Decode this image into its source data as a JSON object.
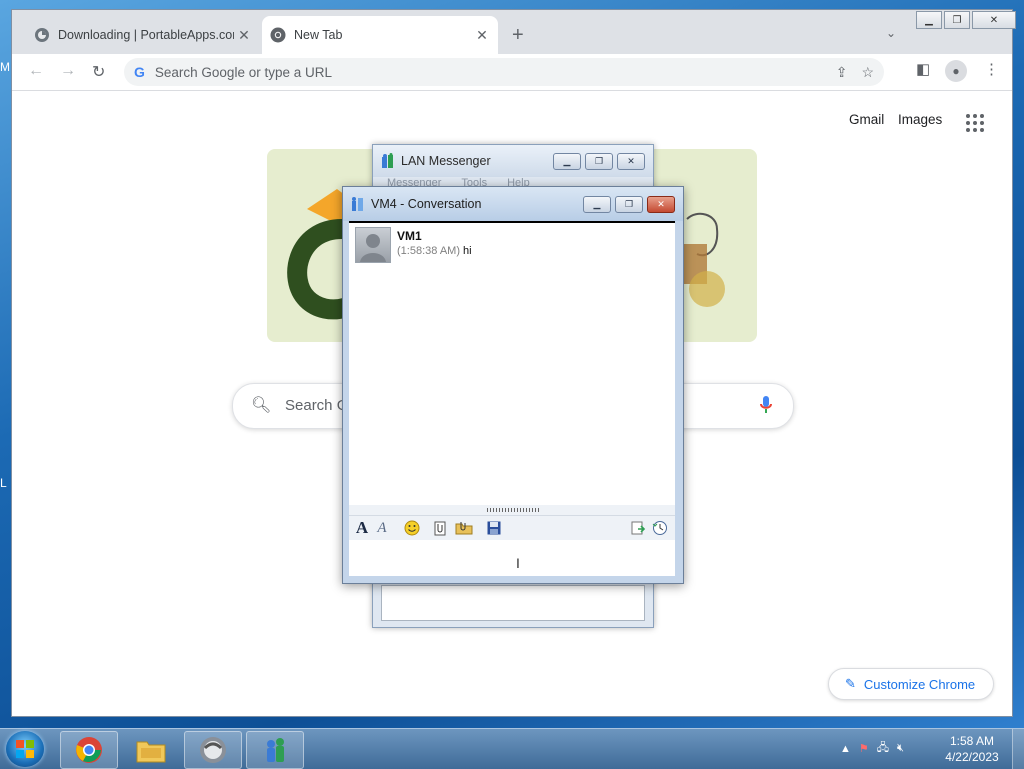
{
  "desktop": {
    "edge_letters": [
      "M",
      "L"
    ]
  },
  "chrome": {
    "tabs": [
      {
        "title": "Downloading | PortableApps.com",
        "favicon": "portableapps-icon",
        "active": false
      },
      {
        "title": "New Tab",
        "favicon": "chrome-icon",
        "active": true
      }
    ],
    "omnibox": {
      "placeholder": "Search Google or type a URL"
    },
    "topnav": {
      "gmail": "Gmail",
      "images": "Images"
    },
    "search": {
      "placeholder": "Search Google or type a URL"
    },
    "customize_label": "Customize Chrome"
  },
  "lan_messenger": {
    "title": "LAN Messenger",
    "menu": [
      "Messenger",
      "Tools",
      "Help"
    ]
  },
  "conversation": {
    "title": "VM4 - Conversation",
    "messages": [
      {
        "sender": "VM1",
        "time": "(1:58:38 AM)",
        "text": "hi"
      }
    ],
    "input_value": ""
  },
  "taskbar": {
    "items": [
      "chrome-icon",
      "file-explorer-icon",
      "portableapps-icon",
      "lan-messenger-icon"
    ],
    "clock": {
      "time": "1:58 AM",
      "date": "4/22/2023"
    }
  },
  "colors": {
    "chrome_accent": "#1a73e8",
    "taskbar": "#4f7aa6",
    "close_button": "#c44a32"
  }
}
